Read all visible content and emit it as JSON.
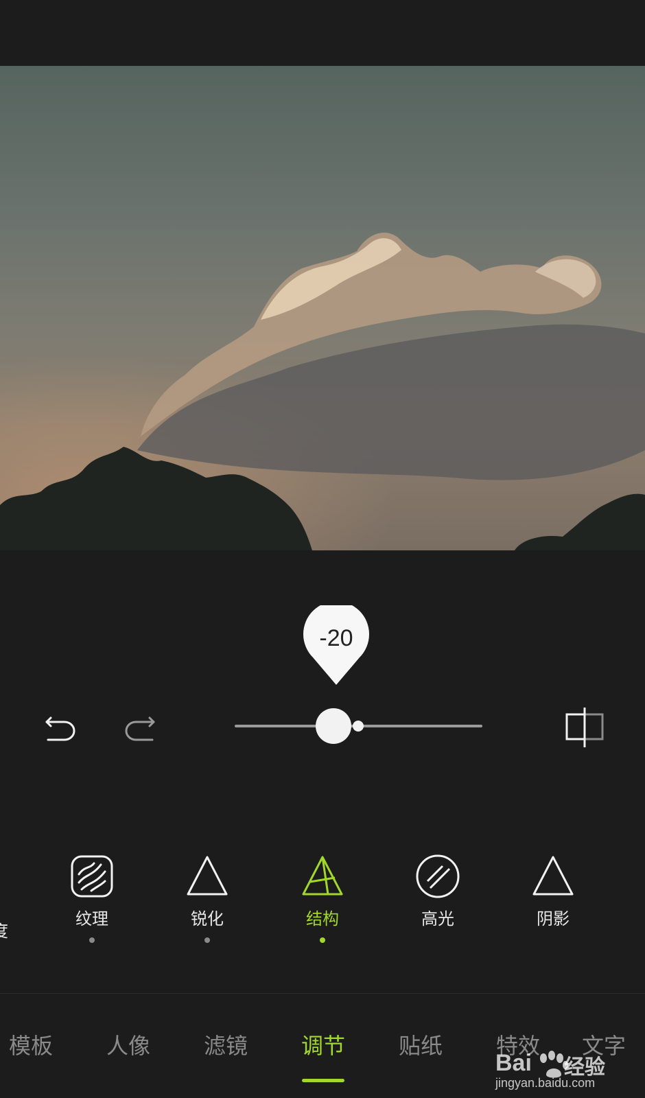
{
  "slider": {
    "value_label": "-20",
    "position_fraction": 0.4
  },
  "tools": {
    "partial_label": "度",
    "items": [
      {
        "label": "纹理",
        "icon": "texture-icon",
        "has_dot": true,
        "active": false
      },
      {
        "label": "锐化",
        "icon": "sharpen-icon",
        "has_dot": true,
        "active": false
      },
      {
        "label": "结构",
        "icon": "structure-icon",
        "has_dot": true,
        "active": true
      },
      {
        "label": "高光",
        "icon": "highlight-icon",
        "has_dot": false,
        "active": false
      },
      {
        "label": "阴影",
        "icon": "shadow-icon",
        "has_dot": false,
        "active": false
      }
    ]
  },
  "tabs": [
    "模板",
    "人像",
    "滤镜",
    "调节",
    "贴纸",
    "特效",
    "文字"
  ],
  "active_tab": "调节",
  "watermark": {
    "brand": "Bai",
    "brand_cn": "经验",
    "url": "jingyan.baidu.com"
  },
  "colors": {
    "accent": "#a2d82a",
    "background": "#1c1c1c",
    "inactive_tab": "#8a8a8a"
  }
}
